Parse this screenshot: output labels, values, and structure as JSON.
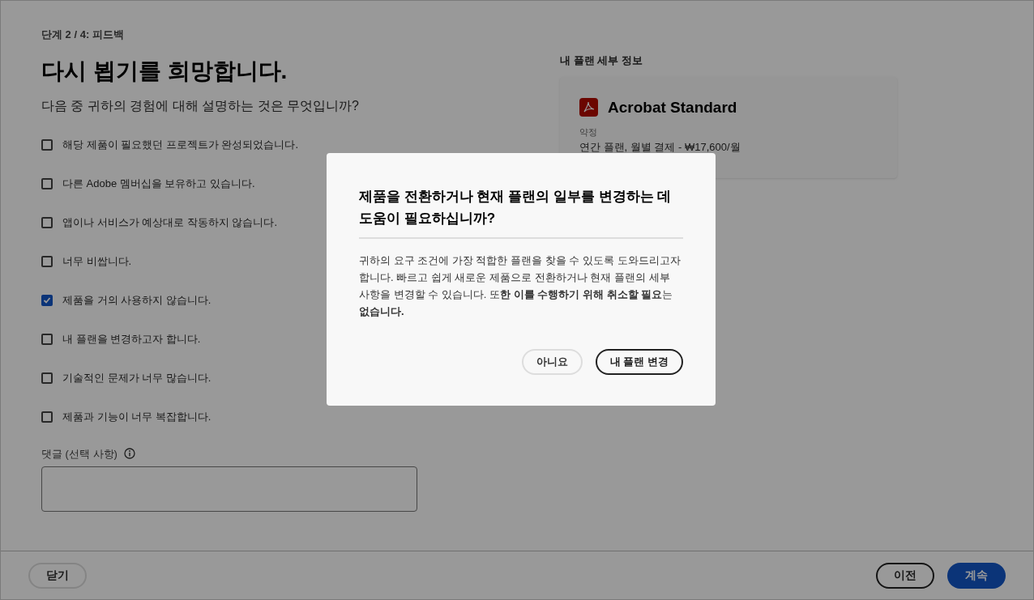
{
  "step": "단계 2 / 4: 피드백",
  "heading": "다시 뵙기를 희망합니다.",
  "question": "다음 중 귀하의 경험에 대해 설명하는 것은 무엇입니까?",
  "options": [
    {
      "label": "해당 제품이 필요했던 프로젝트가 완성되었습니다.",
      "checked": false
    },
    {
      "label": "다른 Adobe 멤버십을 보유하고 있습니다.",
      "checked": false
    },
    {
      "label": "앱이나 서비스가 예상대로 작동하지 않습니다.",
      "checked": false
    },
    {
      "label": "너무 비쌉니다.",
      "checked": false
    },
    {
      "label": "제품을 거의 사용하지 않습니다.",
      "checked": true
    },
    {
      "label": "내 플랜을 변경하고자 합니다.",
      "checked": false
    },
    {
      "label": "기술적인 문제가 너무 많습니다.",
      "checked": false
    },
    {
      "label": "제품과 기능이 너무 복잡합니다.",
      "checked": false
    }
  ],
  "comment": {
    "label": "댓글 (선택 사항)"
  },
  "plan": {
    "title": "내 플랜 세부 정보",
    "product": "Acrobat Standard",
    "term_label": "약정",
    "term": "연간 플랜, 월별 결제 - ₩17,600/월"
  },
  "footer": {
    "close": "닫기",
    "back": "이전",
    "continue": "계속"
  },
  "dialog": {
    "title": "제품을 전환하거나 현재 플랜의 일부를 변경하는 데 도움이 필요하십니까?",
    "body": "귀하의 요구 조건에 가장 적합한 플랜을 찾을 수 있도록 도와드리고자 합니다. 빠르고 쉽게 새로운 제품으로 전환하거나 현재 플랜의 세부 사항을 변경할 수 있습니다. 또**한 이를 수행하기 위해 취소할 필요**는 **없습니다.**",
    "buttons": [
      "아니요",
      "내 플랜 변경"
    ]
  }
}
